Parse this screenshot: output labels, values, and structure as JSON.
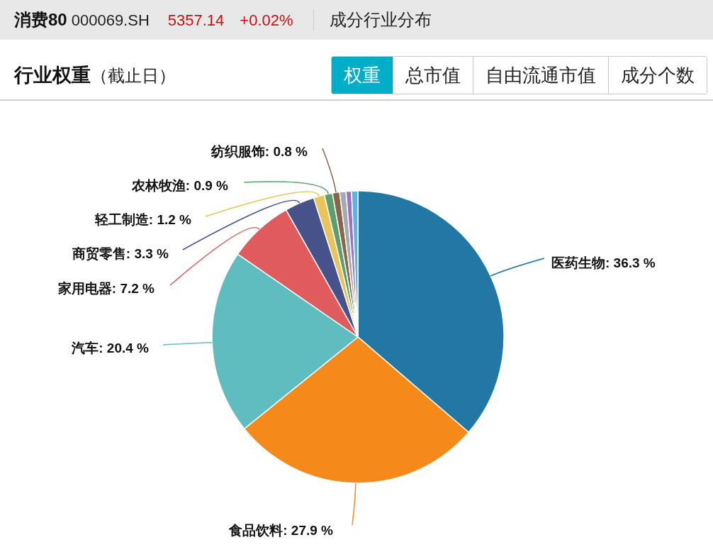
{
  "header": {
    "name": "消费80",
    "code": "000069.SH",
    "price": "5357.14",
    "change": "+0.02%",
    "page_title": "成分行业分布"
  },
  "section": {
    "title": "行业权重",
    "note": "（截止日）"
  },
  "tabs": [
    {
      "label": "权重",
      "selected": true
    },
    {
      "label": "总市值",
      "selected": false
    },
    {
      "label": "自由流通市值",
      "selected": false
    },
    {
      "label": "成分个数",
      "selected": false
    }
  ],
  "chart_data": {
    "type": "pie",
    "values": [
      36.3,
      27.9,
      20.4,
      7.2,
      3.3,
      1.2,
      0.9,
      0.8,
      0.7,
      0.6,
      0.7
    ],
    "colors": [
      "#2377a4",
      "#f58a1b",
      "#5fbdbf",
      "#e05b5d",
      "#47528a",
      "#e8c45a",
      "#5c9e6e",
      "#8b6549",
      "#a3aab2",
      "#9a72c4",
      "#5ab4e5"
    ],
    "value_labels": [
      "医药生物: 36.3 %",
      "食品饮料: 27.9 %",
      "汽车: 20.4 %",
      "家用电器: 7.2 %",
      "商贸零售: 3.3 %",
      "轻工制造: 1.2 %",
      "农林牧渔: 0.9 %",
      "纺织服饰: 0.8 %",
      null,
      null,
      null
    ]
  }
}
